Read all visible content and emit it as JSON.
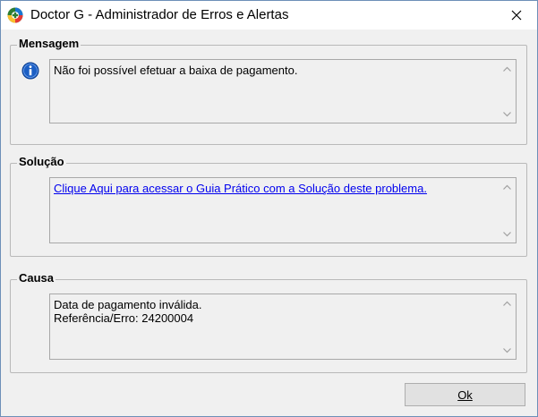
{
  "window": {
    "title": "Doctor G - Administrador de Erros e Alertas"
  },
  "mensagem": {
    "title": "Mensagem",
    "text": "Não foi possível efetuar a baixa de pagamento."
  },
  "solucao": {
    "title": "Solução",
    "link_text": "Clique Aqui para acessar o Guia Prático com a Solução deste problema."
  },
  "causa": {
    "title": "Causa",
    "line1": "Data de pagamento inválida.",
    "line2": "Referência/Erro: 24200004"
  },
  "buttons": {
    "ok_label": "Ok"
  },
  "icons": {
    "app": "doctor-g-logo-icon",
    "info": "info-icon",
    "close": "close-icon",
    "scroll_up": "chevron-up-icon",
    "scroll_down": "chevron-down-icon"
  },
  "colors": {
    "link": "#0000ee",
    "info_blue": "#1c5fc4",
    "border_accent": "#6d8fb8"
  }
}
